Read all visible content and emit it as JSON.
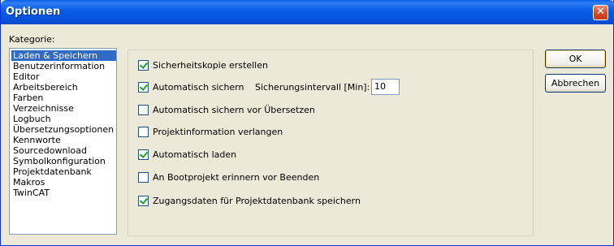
{
  "window": {
    "title": "Optionen",
    "close_glyph": "✕"
  },
  "category": {
    "label": "Kategorie:",
    "items": [
      "Laden & Speichern",
      "Benutzerinformation",
      "Editor",
      "Arbeitsbereich",
      "Farben",
      "Verzeichnisse",
      "Logbuch",
      "Übersetzungsoptionen",
      "Kennworte",
      "Sourcedownload",
      "Symbolkonfiguration",
      "Projektdatenbank",
      "Makros",
      "TwinCAT"
    ],
    "selected": "Laden & Speichern"
  },
  "options": {
    "backup": {
      "label": "Sicherheitskopie erstellen",
      "checked": true
    },
    "autosave": {
      "label": "Automatisch sichern",
      "checked": true
    },
    "interval_label": "Sicherungsintervall [Min]:",
    "interval_value": "10",
    "autosave_before_compile": {
      "label": "Automatisch sichern vor Übersetzen",
      "checked": false
    },
    "request_project_info": {
      "label": "Projektinformation verlangen",
      "checked": false
    },
    "autoload": {
      "label": "Automatisch laden",
      "checked": true
    },
    "remind_bootproject": {
      "label": "An Bootprojekt erinnern vor Beenden",
      "checked": false
    },
    "save_db_credentials": {
      "label": "Zugangsdaten für Projektdatenbank speichern",
      "checked": true
    }
  },
  "buttons": {
    "ok": "OK",
    "cancel": "Abbrechen"
  },
  "colors": {
    "titlebar": "#0554de",
    "selection": "#316ac5",
    "dialog_bg": "#ece9d8"
  }
}
